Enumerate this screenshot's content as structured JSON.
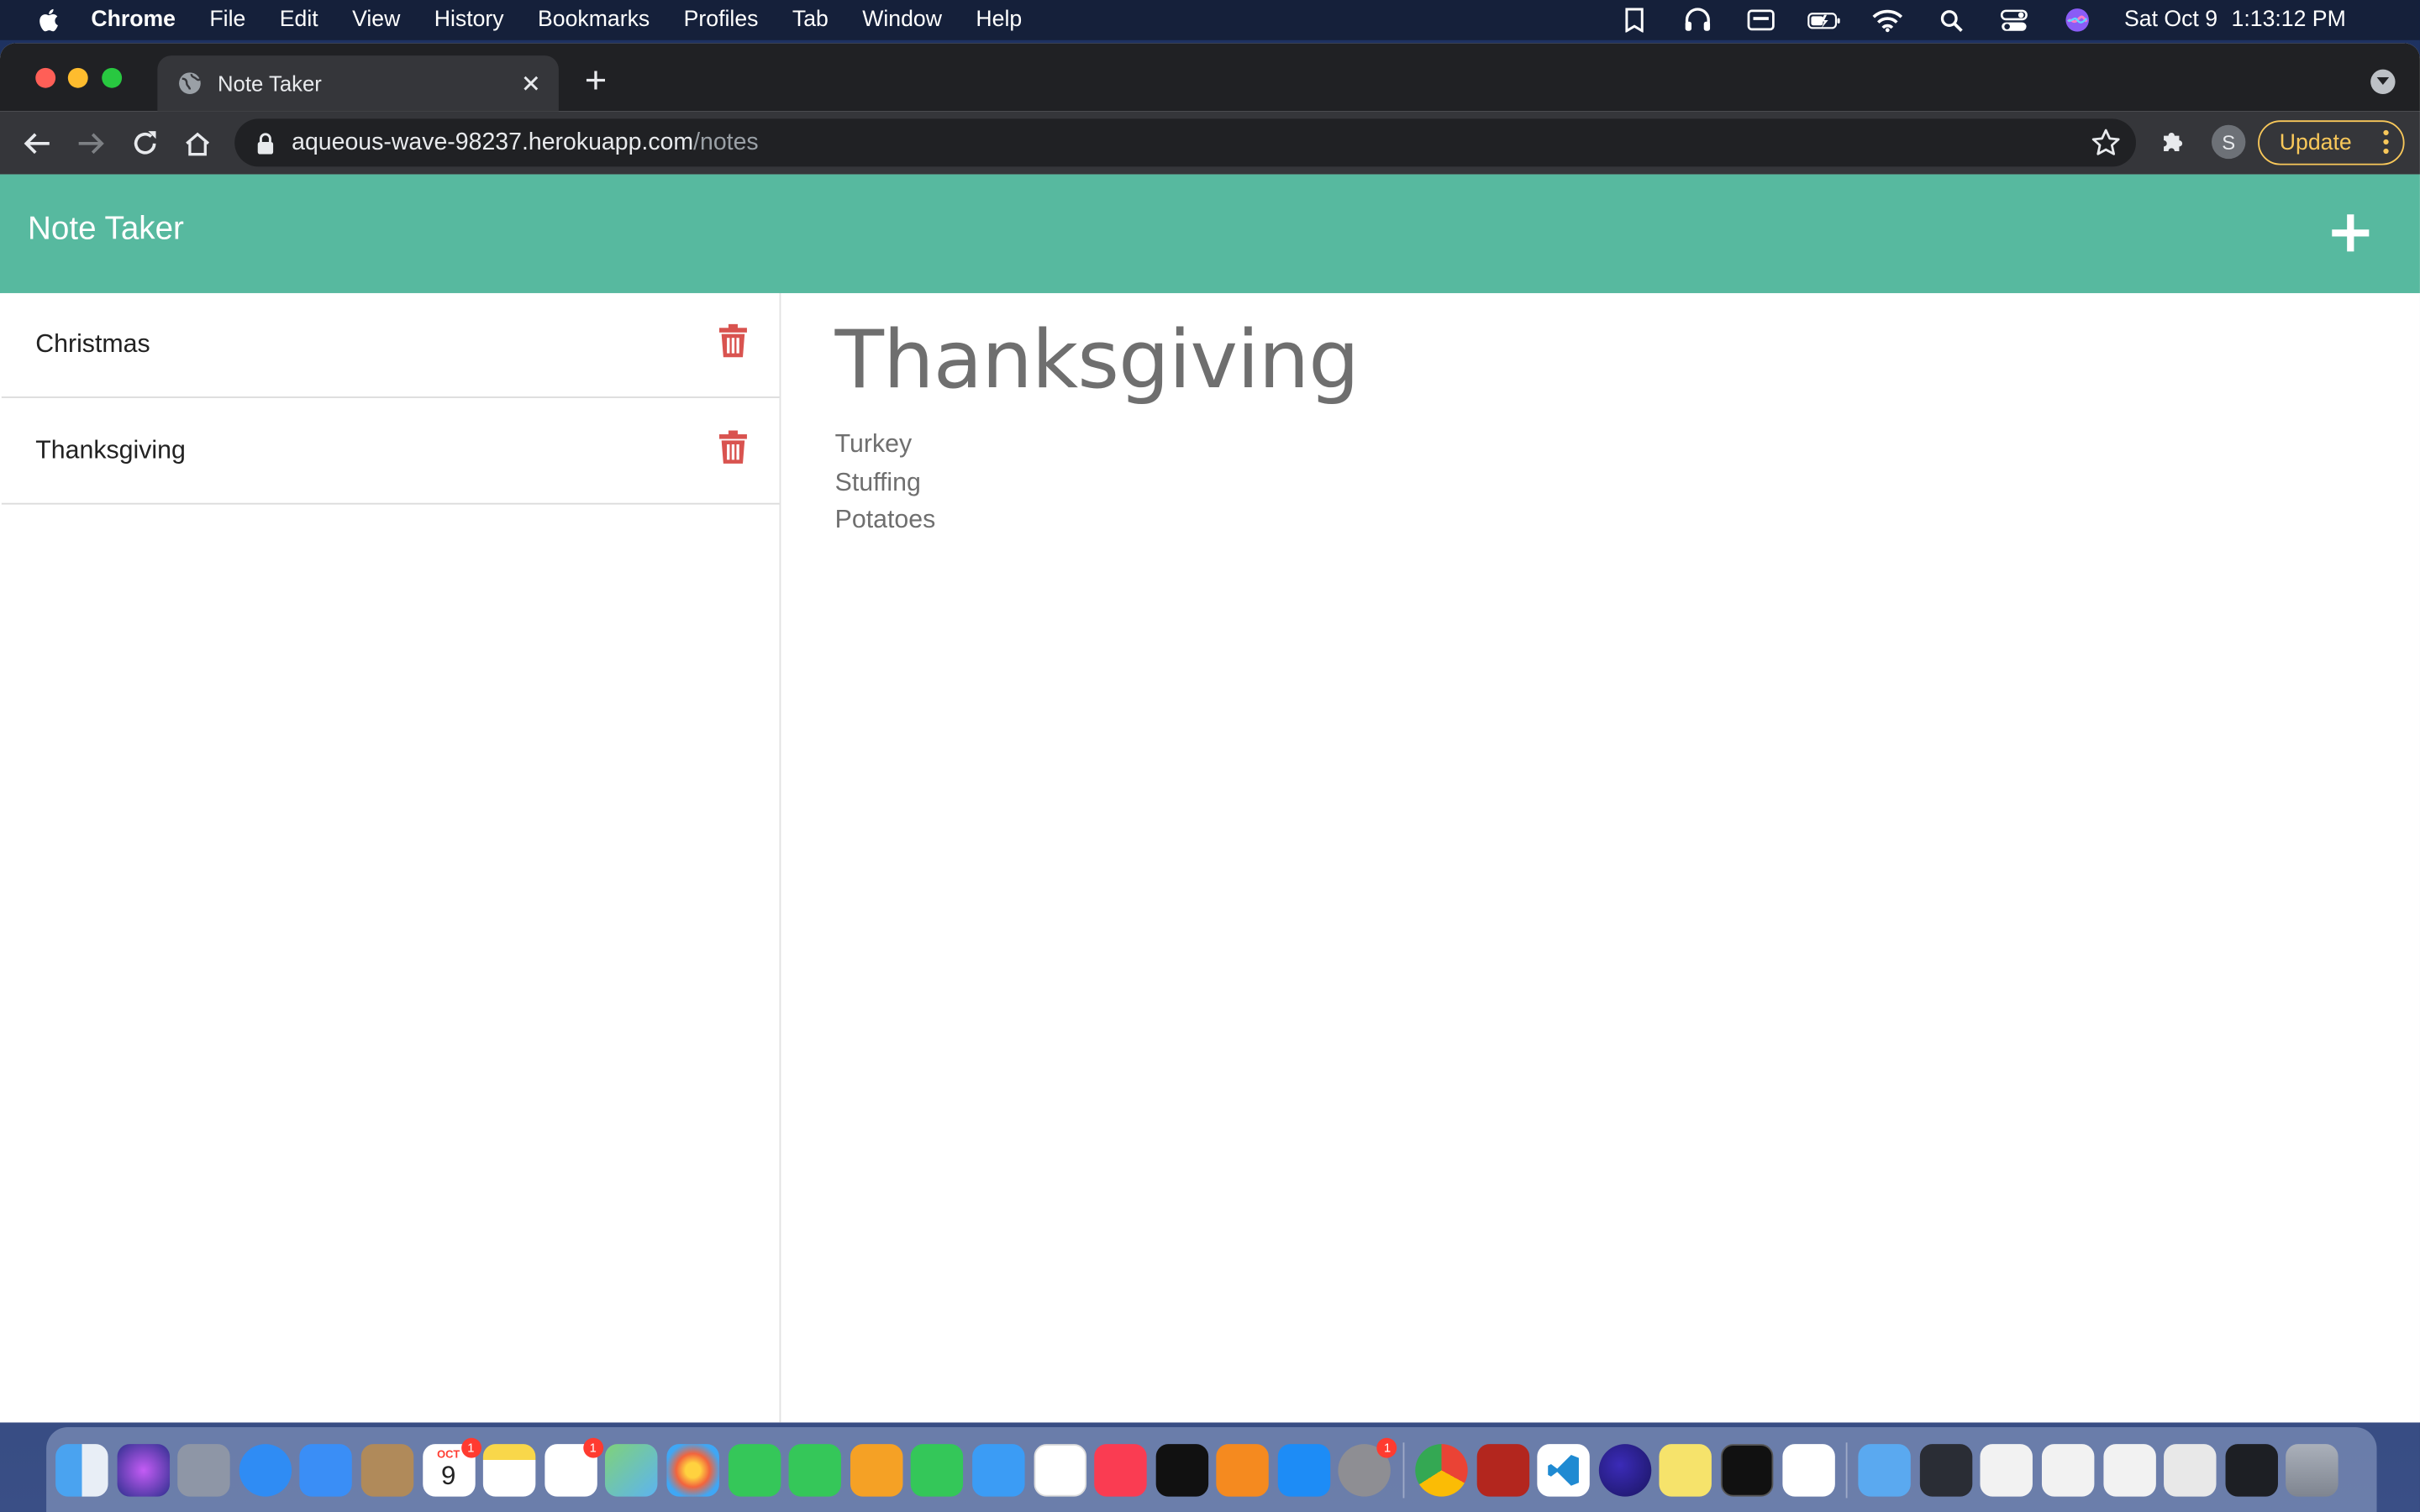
{
  "menubar": {
    "app": "Chrome",
    "items": [
      "File",
      "Edit",
      "View",
      "History",
      "Bookmarks",
      "Profiles",
      "Tab",
      "Window",
      "Help"
    ],
    "date": "Sat Oct 9",
    "time": "1:13:12 PM"
  },
  "browser": {
    "tab_title": "Note Taker",
    "url_host": "aqueous-wave-98237.herokuapp.com",
    "url_path": "/notes",
    "profile_initial": "S",
    "update_label": "Update"
  },
  "app": {
    "brand": "Note Taker",
    "notes": [
      {
        "title": "Christmas"
      },
      {
        "title": "Thanksgiving"
      }
    ],
    "active_note": {
      "title": "Thanksgiving",
      "lines": [
        "Turkey",
        "Stuffing",
        "Potatoes"
      ]
    }
  },
  "colors": {
    "navbar": "#57b99f",
    "trash": "#d9534f",
    "update_accent": "#f9c85a"
  },
  "dock": {
    "calendar_month": "OCT",
    "calendar_day": "9",
    "badges": {
      "calendar": "1",
      "reminders": "1",
      "settings": "1"
    }
  }
}
